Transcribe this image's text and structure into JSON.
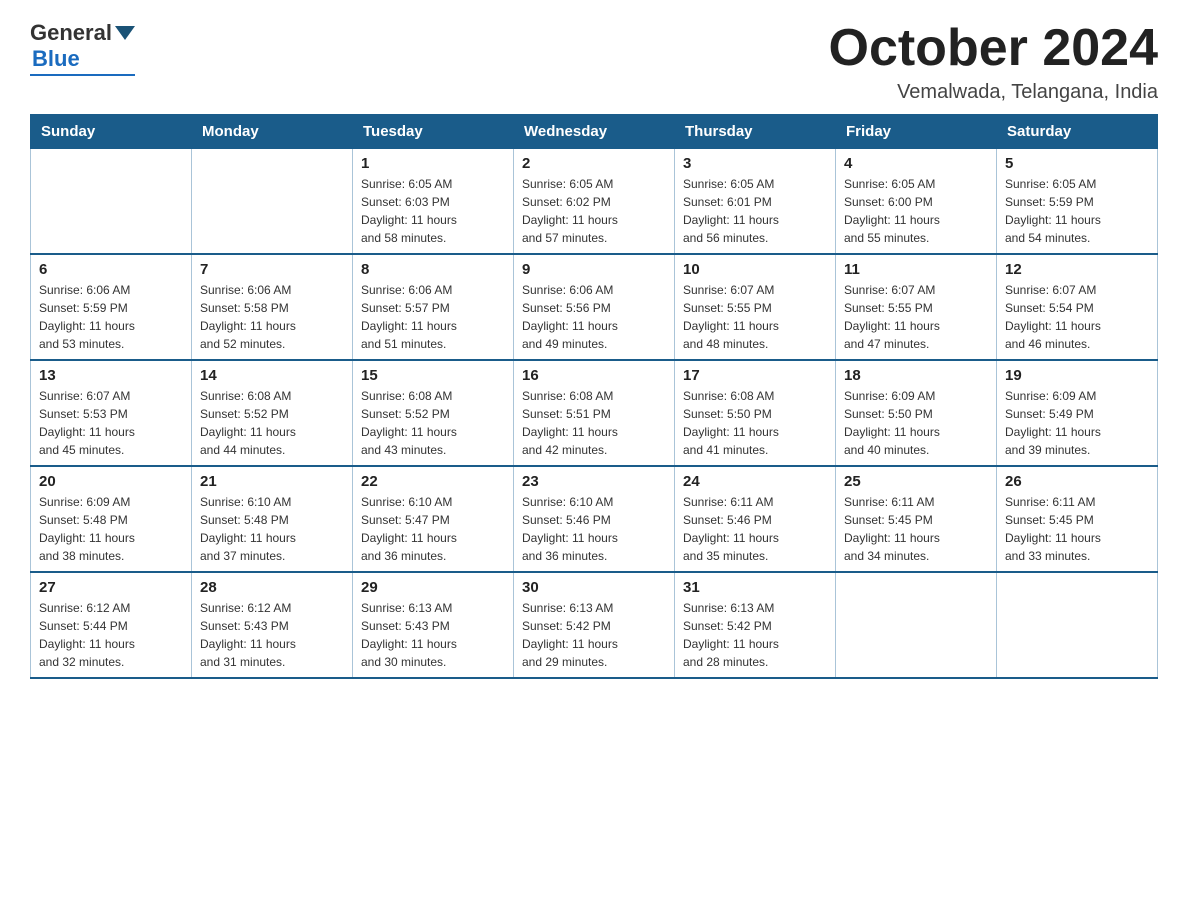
{
  "header": {
    "logo_general": "General",
    "logo_blue": "Blue",
    "month_title": "October 2024",
    "subtitle": "Vemalwada, Telangana, India"
  },
  "days_of_week": [
    "Sunday",
    "Monday",
    "Tuesday",
    "Wednesday",
    "Thursday",
    "Friday",
    "Saturday"
  ],
  "weeks": [
    [
      {
        "day": "",
        "info": ""
      },
      {
        "day": "",
        "info": ""
      },
      {
        "day": "1",
        "info": "Sunrise: 6:05 AM\nSunset: 6:03 PM\nDaylight: 11 hours\nand 58 minutes."
      },
      {
        "day": "2",
        "info": "Sunrise: 6:05 AM\nSunset: 6:02 PM\nDaylight: 11 hours\nand 57 minutes."
      },
      {
        "day": "3",
        "info": "Sunrise: 6:05 AM\nSunset: 6:01 PM\nDaylight: 11 hours\nand 56 minutes."
      },
      {
        "day": "4",
        "info": "Sunrise: 6:05 AM\nSunset: 6:00 PM\nDaylight: 11 hours\nand 55 minutes."
      },
      {
        "day": "5",
        "info": "Sunrise: 6:05 AM\nSunset: 5:59 PM\nDaylight: 11 hours\nand 54 minutes."
      }
    ],
    [
      {
        "day": "6",
        "info": "Sunrise: 6:06 AM\nSunset: 5:59 PM\nDaylight: 11 hours\nand 53 minutes."
      },
      {
        "day": "7",
        "info": "Sunrise: 6:06 AM\nSunset: 5:58 PM\nDaylight: 11 hours\nand 52 minutes."
      },
      {
        "day": "8",
        "info": "Sunrise: 6:06 AM\nSunset: 5:57 PM\nDaylight: 11 hours\nand 51 minutes."
      },
      {
        "day": "9",
        "info": "Sunrise: 6:06 AM\nSunset: 5:56 PM\nDaylight: 11 hours\nand 49 minutes."
      },
      {
        "day": "10",
        "info": "Sunrise: 6:07 AM\nSunset: 5:55 PM\nDaylight: 11 hours\nand 48 minutes."
      },
      {
        "day": "11",
        "info": "Sunrise: 6:07 AM\nSunset: 5:55 PM\nDaylight: 11 hours\nand 47 minutes."
      },
      {
        "day": "12",
        "info": "Sunrise: 6:07 AM\nSunset: 5:54 PM\nDaylight: 11 hours\nand 46 minutes."
      }
    ],
    [
      {
        "day": "13",
        "info": "Sunrise: 6:07 AM\nSunset: 5:53 PM\nDaylight: 11 hours\nand 45 minutes."
      },
      {
        "day": "14",
        "info": "Sunrise: 6:08 AM\nSunset: 5:52 PM\nDaylight: 11 hours\nand 44 minutes."
      },
      {
        "day": "15",
        "info": "Sunrise: 6:08 AM\nSunset: 5:52 PM\nDaylight: 11 hours\nand 43 minutes."
      },
      {
        "day": "16",
        "info": "Sunrise: 6:08 AM\nSunset: 5:51 PM\nDaylight: 11 hours\nand 42 minutes."
      },
      {
        "day": "17",
        "info": "Sunrise: 6:08 AM\nSunset: 5:50 PM\nDaylight: 11 hours\nand 41 minutes."
      },
      {
        "day": "18",
        "info": "Sunrise: 6:09 AM\nSunset: 5:50 PM\nDaylight: 11 hours\nand 40 minutes."
      },
      {
        "day": "19",
        "info": "Sunrise: 6:09 AM\nSunset: 5:49 PM\nDaylight: 11 hours\nand 39 minutes."
      }
    ],
    [
      {
        "day": "20",
        "info": "Sunrise: 6:09 AM\nSunset: 5:48 PM\nDaylight: 11 hours\nand 38 minutes."
      },
      {
        "day": "21",
        "info": "Sunrise: 6:10 AM\nSunset: 5:48 PM\nDaylight: 11 hours\nand 37 minutes."
      },
      {
        "day": "22",
        "info": "Sunrise: 6:10 AM\nSunset: 5:47 PM\nDaylight: 11 hours\nand 36 minutes."
      },
      {
        "day": "23",
        "info": "Sunrise: 6:10 AM\nSunset: 5:46 PM\nDaylight: 11 hours\nand 36 minutes."
      },
      {
        "day": "24",
        "info": "Sunrise: 6:11 AM\nSunset: 5:46 PM\nDaylight: 11 hours\nand 35 minutes."
      },
      {
        "day": "25",
        "info": "Sunrise: 6:11 AM\nSunset: 5:45 PM\nDaylight: 11 hours\nand 34 minutes."
      },
      {
        "day": "26",
        "info": "Sunrise: 6:11 AM\nSunset: 5:45 PM\nDaylight: 11 hours\nand 33 minutes."
      }
    ],
    [
      {
        "day": "27",
        "info": "Sunrise: 6:12 AM\nSunset: 5:44 PM\nDaylight: 11 hours\nand 32 minutes."
      },
      {
        "day": "28",
        "info": "Sunrise: 6:12 AM\nSunset: 5:43 PM\nDaylight: 11 hours\nand 31 minutes."
      },
      {
        "day": "29",
        "info": "Sunrise: 6:13 AM\nSunset: 5:43 PM\nDaylight: 11 hours\nand 30 minutes."
      },
      {
        "day": "30",
        "info": "Sunrise: 6:13 AM\nSunset: 5:42 PM\nDaylight: 11 hours\nand 29 minutes."
      },
      {
        "day": "31",
        "info": "Sunrise: 6:13 AM\nSunset: 5:42 PM\nDaylight: 11 hours\nand 28 minutes."
      },
      {
        "day": "",
        "info": ""
      },
      {
        "day": "",
        "info": ""
      }
    ]
  ]
}
